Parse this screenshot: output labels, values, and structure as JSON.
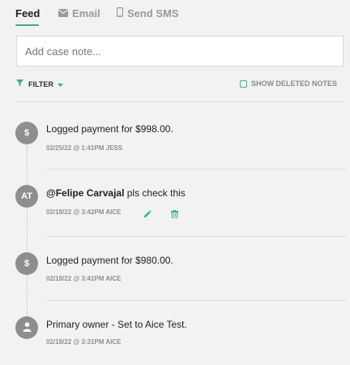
{
  "tabs": [
    {
      "label": "Feed",
      "icon": "feed"
    },
    {
      "label": "Email",
      "icon": "envelope-icon"
    },
    {
      "label": "Send SMS",
      "icon": "mobile-phone-icon"
    }
  ],
  "note_input": {
    "placeholder": "Add case note...",
    "value": ""
  },
  "filter": {
    "label": "FILTER",
    "icon": "funnel-icon"
  },
  "show_deleted": {
    "label": "SHOW DELETED NOTES",
    "checked": false
  },
  "colors": {
    "accent": "#2eb872",
    "avatar_bg": "#8e8e8e",
    "background": "#f2f2f2"
  },
  "entries": [
    {
      "avatar": "$",
      "text": "Logged payment for $998.00.",
      "meta": "02/25/22 @ 1:41PM JESS",
      "actions": []
    },
    {
      "avatar": "AT",
      "mention": "@Felipe Carvajal",
      "text": " pls check this",
      "meta": "02/18/22 @ 3:42PM AICE",
      "actions": [
        "edit-icon",
        "trash-icon"
      ]
    },
    {
      "avatar": "$",
      "text": "Logged payment for $980.00.",
      "meta": "02/18/22 @ 3:41PM AICE",
      "actions": []
    },
    {
      "avatar": "person-icon",
      "text": "Primary owner - Set to Aice Test.",
      "meta": "02/18/22 @ 3:31PM AICE",
      "actions": []
    }
  ]
}
